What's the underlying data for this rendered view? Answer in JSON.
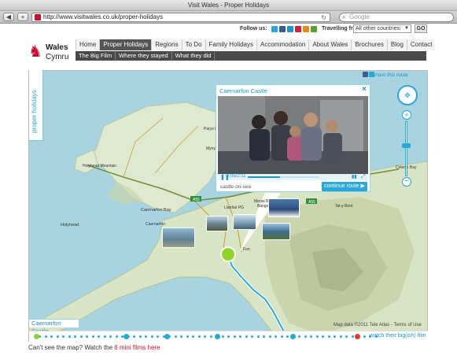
{
  "browser": {
    "title": "Visit Wales - Proper Holidays",
    "url": "http://www.visitwales.co.uk/proper-holidays",
    "search_placeholder": "Google"
  },
  "header": {
    "follow_label": "Follow us:",
    "travel_label": "Travelling from:",
    "country_value": "All other countries:",
    "go_label": "GO",
    "logo_line1": "Wales",
    "logo_line2": "Cymru"
  },
  "nav": {
    "items": [
      "Home",
      "Proper Holidays",
      "Regions",
      "To Do",
      "Family Holidays",
      "Accommodation",
      "About Wales",
      "Brochures",
      "Blog",
      "Contact"
    ],
    "active": "Proper Holidays",
    "sub_items": [
      "The Big Film",
      "Where they stayed",
      "What they did"
    ]
  },
  "map": {
    "side_tab": "proper holidays",
    "share_label": "share this route",
    "location_label": "Caernarfon Castle",
    "map_data": "Map data ©2011 Tele Atlas - Terms of Use",
    "timeline_link": "watch their big(ish) film",
    "place_names": {
      "holyhead": "Holyhead",
      "holyhead_mountain": "Holyhead Mountain",
      "parys": "Parys Mountain",
      "mynydd": "Mynydd Bodafon",
      "caernarfon": "Caernarfon",
      "caernarfon_bay": "Caernarfon Bay",
      "llanfair": "Llanfair PG",
      "menai": "Menai Bridge",
      "bangor": "Bangor",
      "conwy": "Colwyn Bay",
      "tal_y_bont": "Tal-y-Bont",
      "foelgron": "Fon"
    },
    "road_labels": [
      "A55",
      "A55"
    ]
  },
  "popup": {
    "title": "Caernarfon Castle",
    "time": "0:05/2:11",
    "progress": 0.45,
    "caption": "castle-on-sea",
    "continue_label": "continue route"
  },
  "footer": {
    "text": "Can't see the map? Watch the ",
    "link": "6 mini films here"
  },
  "colors": {
    "brand_red": "#c8102e",
    "accent_blue": "#2aa8d8",
    "pin_green": "#8fd42a",
    "sea": "#aad3df"
  }
}
